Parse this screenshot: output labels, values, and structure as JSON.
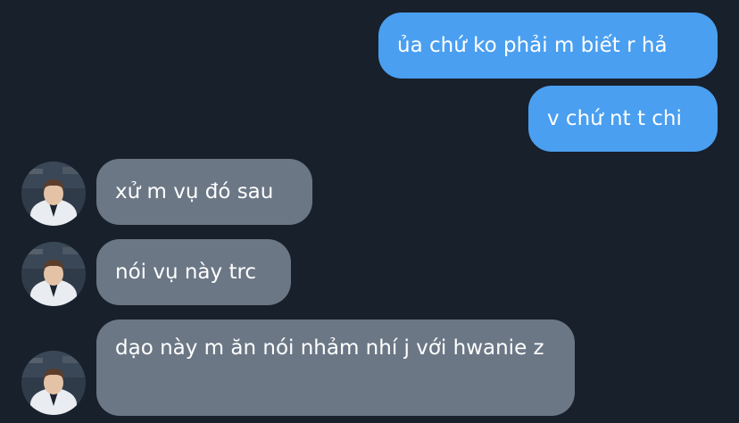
{
  "conversation": {
    "sent": [
      {
        "text": "ủa chứ ko phải m biết r hả"
      },
      {
        "text": "v chứ nt t chi"
      }
    ],
    "received": [
      {
        "text": "xử m vụ đó sau"
      },
      {
        "text": "nói vụ này trc"
      },
      {
        "text": "dạo này m ăn nói nhảm nhí j với hwanie z"
      }
    ]
  },
  "colors": {
    "background": "#18202b",
    "sent_bubble": "#4a9ff0",
    "received_bubble": "#6b7785",
    "text": "#ffffff"
  },
  "icons": {
    "avatar": "contact-avatar-photo"
  }
}
